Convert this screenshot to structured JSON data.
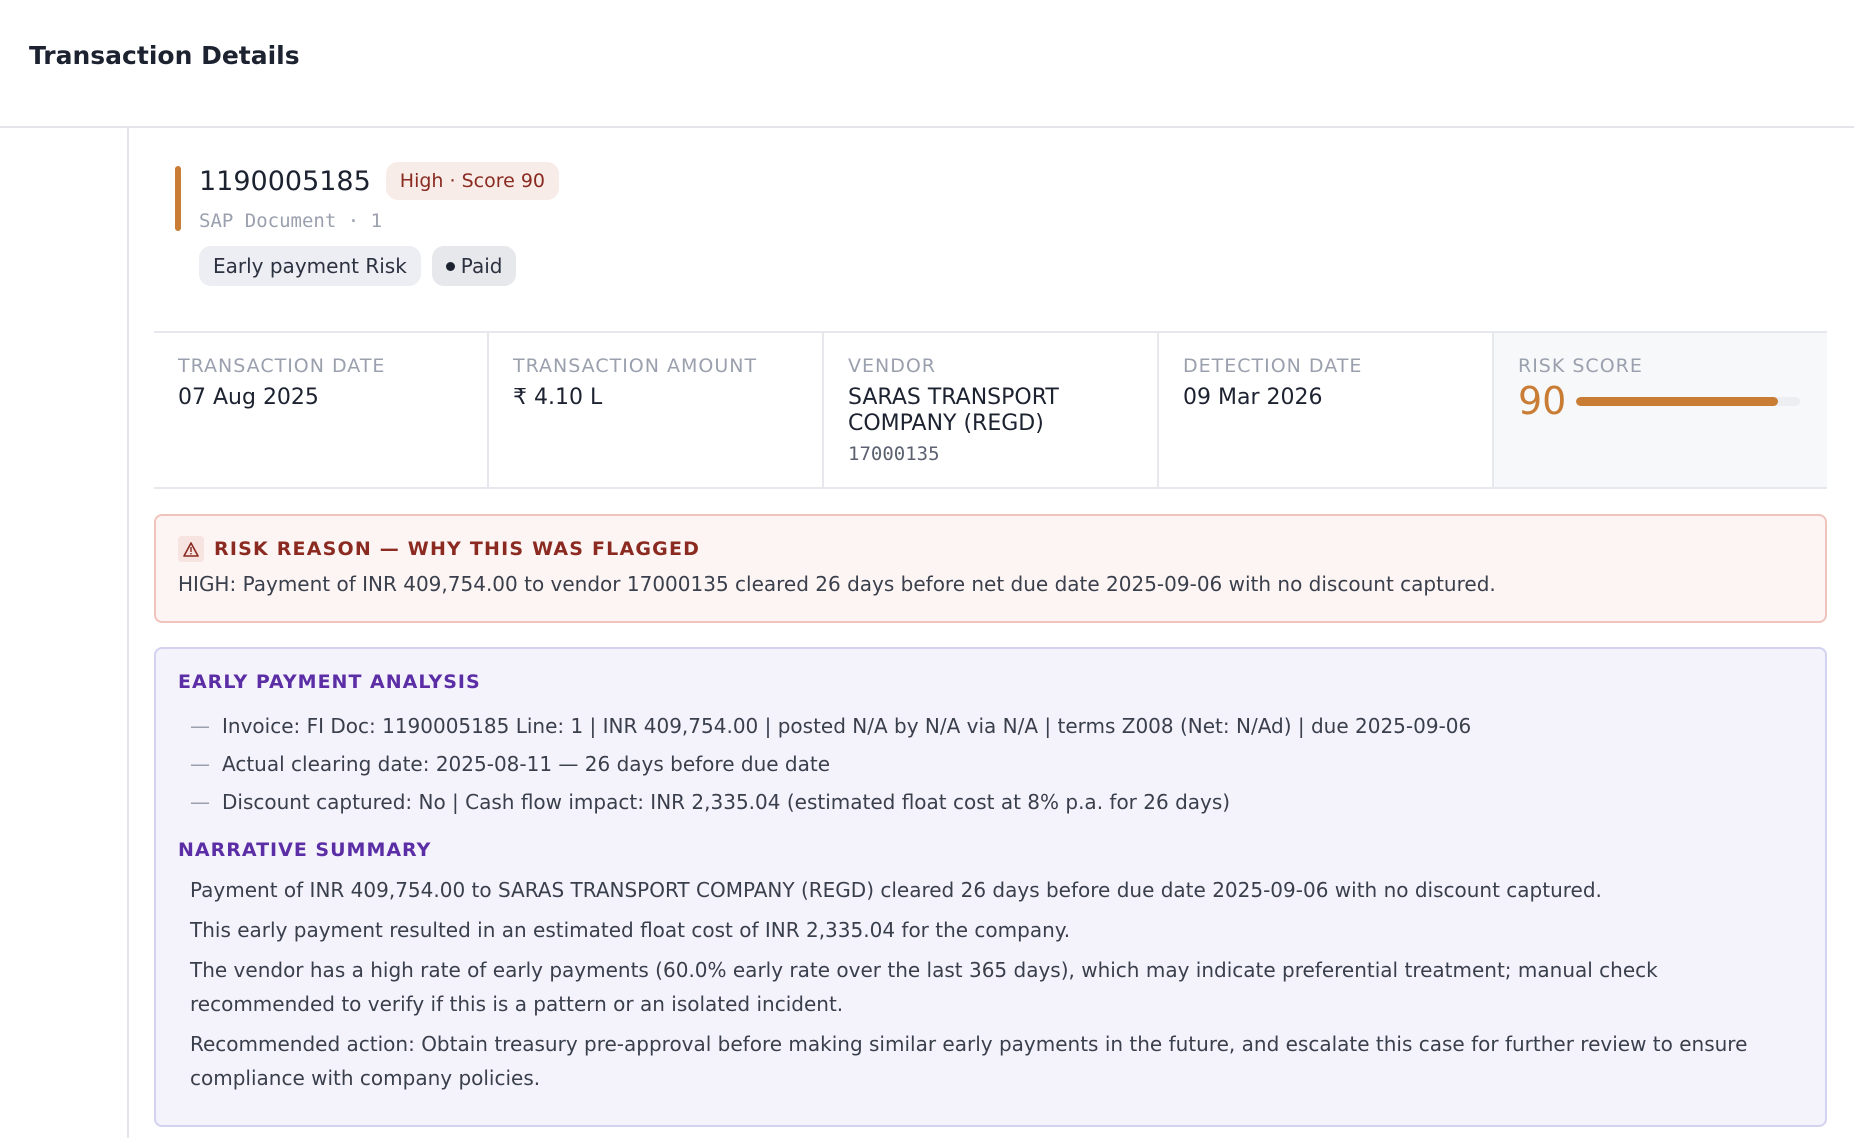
{
  "page": {
    "title": "Transaction Details"
  },
  "header": {
    "doc_number": "1190005185",
    "risk_pill": "High · Score 90",
    "doc_meta": "SAP Document · 1",
    "tags": {
      "type": "Early payment Risk",
      "status": "Paid"
    }
  },
  "stats": {
    "transaction_date": {
      "label": "TRANSACTION DATE",
      "value": "07 Aug 2025"
    },
    "transaction_amount": {
      "label": "TRANSACTION AMOUNT",
      "value": "₹ 4.10 L"
    },
    "vendor": {
      "label": "VENDOR",
      "value": "SARAS TRANSPORT COMPANY (REGD)",
      "id": "17000135"
    },
    "detection_date": {
      "label": "DETECTION DATE",
      "value": "09 Mar 2026"
    },
    "risk_score": {
      "label": "RISK SCORE",
      "value": "90",
      "fraction": 0.9,
      "color": "#c97c34"
    }
  },
  "risk_reason": {
    "title": "RISK REASON — WHY THIS WAS FLAGGED",
    "icon": "warning-icon",
    "text": "HIGH: Payment of INR 409,754.00 to vendor 17000135 cleared 26 days before net due date 2025-09-06 with no discount captured."
  },
  "analysis": {
    "title": "EARLY PAYMENT ANALYSIS",
    "items": [
      "Invoice: FI Doc: 1190005185 Line: 1 | INR 409,754.00 | posted N/A by N/A via N/A | terms Z008 (Net: N/Ad) | due 2025-09-06",
      "Actual clearing date: 2025-08-11 — 26 days before due date",
      "Discount captured: No | Cash flow impact: INR 2,335.04 (estimated float cost at 8% p.a. for 26 days)"
    ],
    "narrative_title": "NARRATIVE SUMMARY",
    "narrative": [
      "Payment of INR 409,754.00 to SARAS TRANSPORT COMPANY (REGD) cleared 26 days before due date 2025-09-06 with no discount captured.",
      "This early payment resulted in an estimated float cost of INR 2,335.04 for the company.",
      "The vendor has a high rate of early payments (60.0% early rate over the last 365 days), which may indicate preferential treatment; manual check recommended to verify if this is a pattern or an isolated incident.",
      "Recommended action: Obtain treasury pre-approval before making similar early payments in the future, and escalate this case for further review to ensure compliance with company policies."
    ]
  }
}
